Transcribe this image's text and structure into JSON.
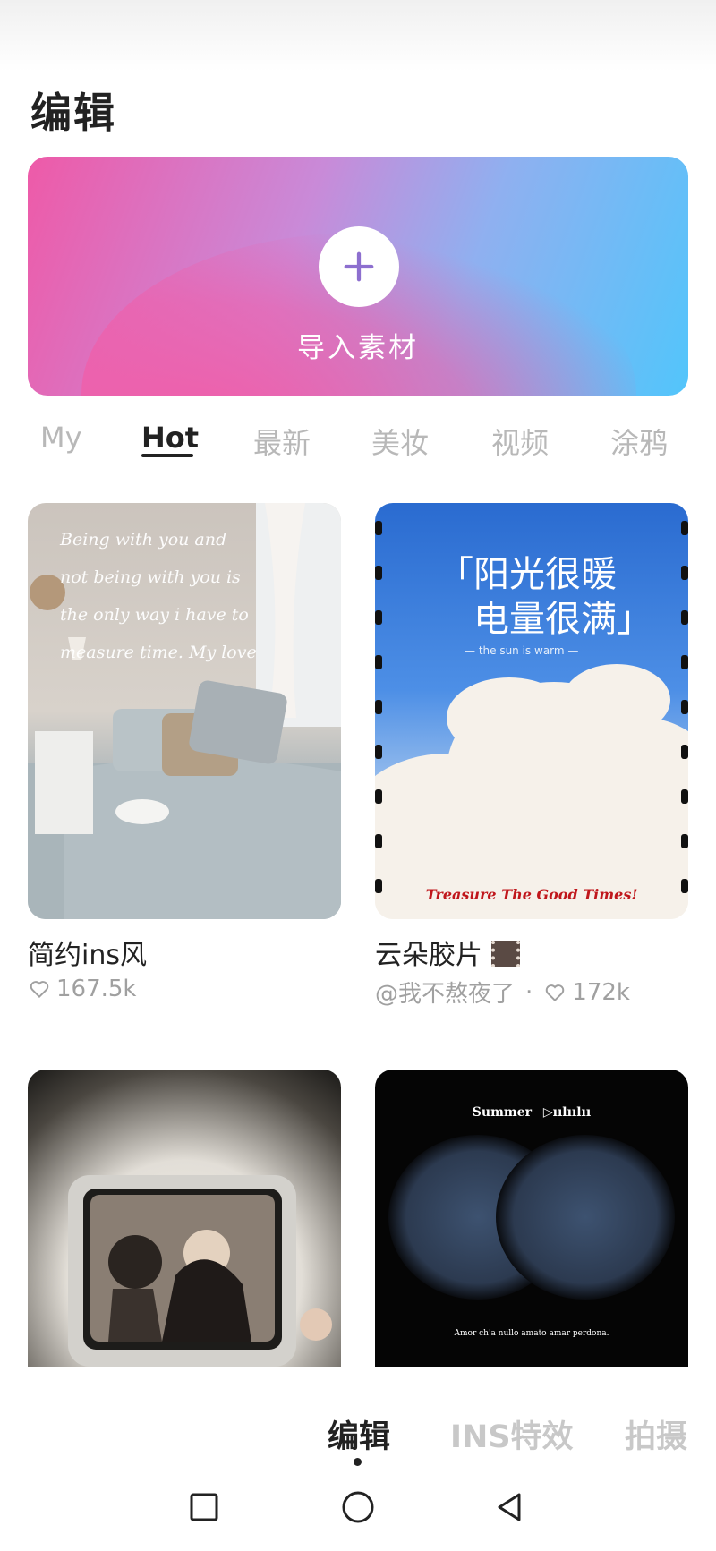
{
  "header": {
    "title": "编辑"
  },
  "import_banner": {
    "label": "导入素材",
    "icon": "plus-icon"
  },
  "tabs": [
    {
      "label": "My"
    },
    {
      "label": "Hot",
      "active": true
    },
    {
      "label": "最新"
    },
    {
      "label": "美妆"
    },
    {
      "label": "视频"
    },
    {
      "label": "涂鸦"
    }
  ],
  "cards": [
    {
      "title": "简约ins风",
      "likes": "167.5k",
      "thumb_text": [
        "Being with you and",
        "not being with you is",
        "the only way i have to",
        "measure time. My love"
      ]
    },
    {
      "title": "云朵胶片",
      "author": "@我不熬夜了",
      "separator": "·",
      "likes": "172k",
      "thumb_text": {
        "headline_1": "「阳光很暖",
        "headline_2": "电量很满」",
        "small": "— the sun is warm —",
        "footer": "Treasure The Good Times!"
      }
    },
    {
      "title": "",
      "likes": ""
    },
    {
      "title": "",
      "likes": "",
      "thumb_text": {
        "top": "Summer",
        "bottom": "Amor ch'a nullo amato amar perdona."
      }
    }
  ],
  "bottom_tabs": [
    {
      "label": "编辑",
      "active": true
    },
    {
      "label": "INS特效"
    },
    {
      "label": "拍摄"
    }
  ],
  "system_nav": [
    "recents-button",
    "home-button",
    "back-button"
  ],
  "colors": {
    "banner_start": "#ee5aa8",
    "banner_end": "#52c5fb",
    "inactive": "#b8b8b8",
    "text": "#222222"
  }
}
